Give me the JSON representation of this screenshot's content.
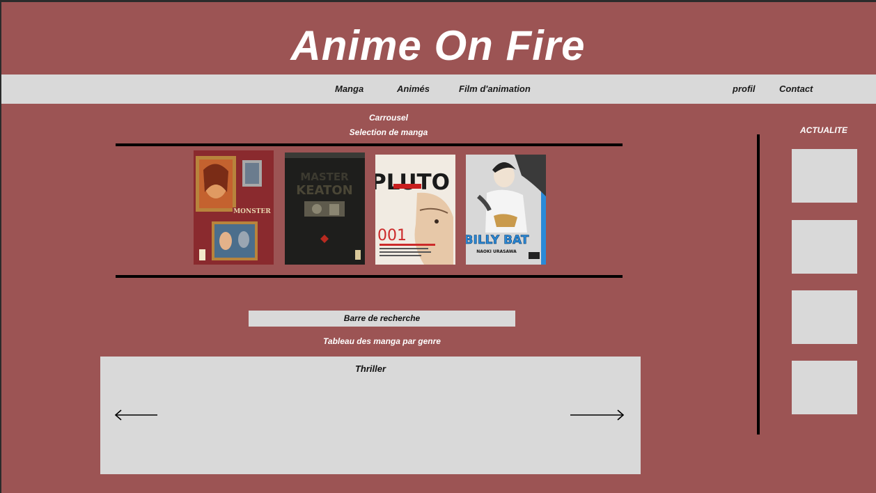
{
  "site": {
    "title": "Anime On Fire"
  },
  "nav": {
    "manga": "Manga",
    "animes": "Animés",
    "films": "Film d'animation",
    "profil": "profil",
    "contact": "Contact"
  },
  "carousel": {
    "title": "Carrousel",
    "subtitle": "Selection de manga",
    "covers": [
      {
        "label": "MONSTER",
        "icon": "manga-cover-monster"
      },
      {
        "label": "MASTER KEATON",
        "icon": "manga-cover-master-keaton"
      },
      {
        "label": "PLUTO",
        "number": "001",
        "icon": "manga-cover-pluto"
      },
      {
        "label": "BILLY BAT",
        "author": "NAOKI URASAWA",
        "icon": "manga-cover-billy-bat"
      }
    ]
  },
  "search": {
    "placeholder": "Barre de recherche"
  },
  "genre_table": {
    "title": "Tableau des manga par genre",
    "genre": "Thriller"
  },
  "news": {
    "title": "ACTUALITE",
    "items": 4
  },
  "colors": {
    "background": "#9c5454",
    "panel": "#d9d9d9",
    "text_light": "#ffffff",
    "text_dark": "#111111"
  }
}
